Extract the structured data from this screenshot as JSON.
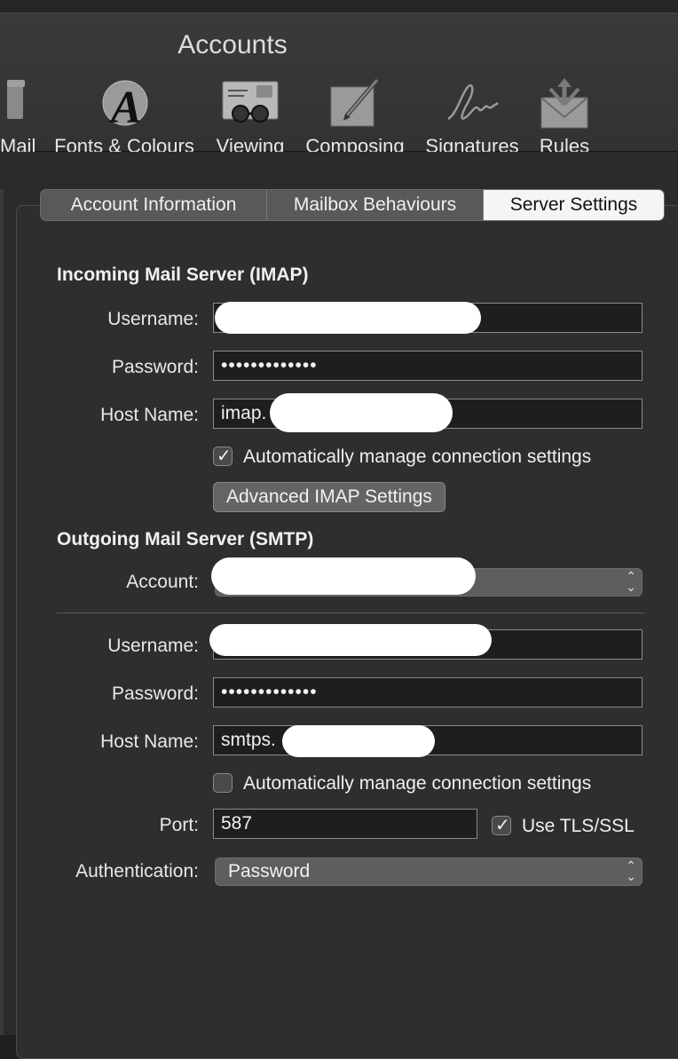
{
  "window": {
    "title": "Accounts"
  },
  "toolbar": {
    "items": [
      {
        "label": "Mail",
        "icon": "mail-icon"
      },
      {
        "label": "Fonts & Colours",
        "icon": "fonts-icon"
      },
      {
        "label": "Viewing",
        "icon": "viewing-icon"
      },
      {
        "label": "Composing",
        "icon": "composing-icon"
      },
      {
        "label": "Signatures",
        "icon": "signature-icon"
      },
      {
        "label": "Rules",
        "icon": "rules-icon"
      }
    ]
  },
  "tabs": [
    {
      "label": "Account Information",
      "selected": false
    },
    {
      "label": "Mailbox Behaviours",
      "selected": false
    },
    {
      "label": "Server Settings",
      "selected": true
    }
  ],
  "incoming": {
    "title": "Incoming Mail Server (IMAP)",
    "username_label": "Username:",
    "username_value": "",
    "password_label": "Password:",
    "password_value": "•••••••••••••",
    "host_label": "Host Name:",
    "host_value": "imap.",
    "auto_manage": {
      "label": "Automatically manage connection settings",
      "checked": true
    },
    "advanced_button": "Advanced IMAP Settings"
  },
  "outgoing": {
    "title": "Outgoing Mail Server (SMTP)",
    "account_label": "Account:",
    "account_value": "",
    "username_label": "Username:",
    "username_value": "",
    "password_label": "Password:",
    "password_value": "•••••••••••••",
    "host_label": "Host Name:",
    "host_value": "smtps.",
    "auto_manage": {
      "label": "Automatically manage connection settings",
      "checked": false
    },
    "port_label": "Port:",
    "port_value": "587",
    "tls": {
      "label": "Use TLS/SSL",
      "checked": true
    },
    "auth_label": "Authentication:",
    "auth_value": "Password"
  }
}
